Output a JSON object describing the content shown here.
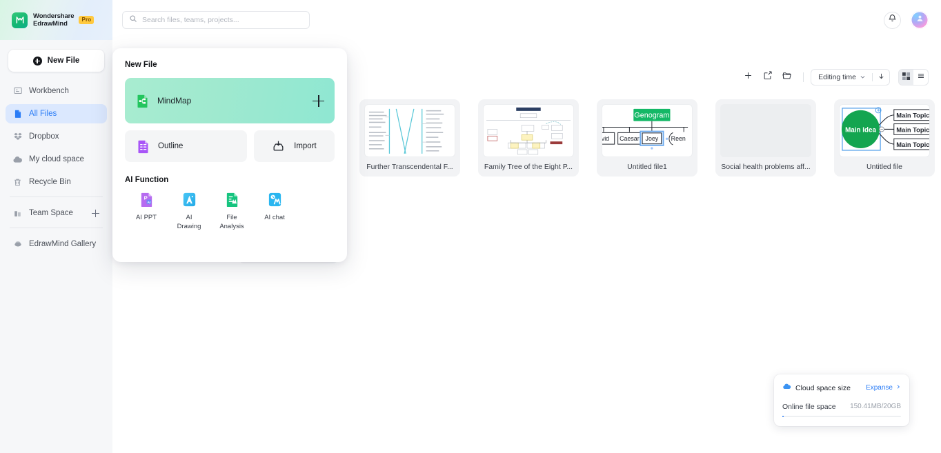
{
  "brand": {
    "name_line1": "Wondershare",
    "name_line2": "EdrawMind",
    "badge": "Pro",
    "logo_icon": "edrawmind-logo-icon"
  },
  "sidebar": {
    "new_file_button": "New File",
    "items": [
      {
        "label": "Workbench",
        "icon": "workbench-icon",
        "active": false
      },
      {
        "label": "All Files",
        "icon": "files-icon",
        "active": true
      },
      {
        "label": "Dropbox",
        "icon": "dropbox-icon",
        "active": false
      },
      {
        "label": "My cloud space",
        "icon": "cloud-icon",
        "active": false
      },
      {
        "label": "Recycle Bin",
        "icon": "trash-icon",
        "active": false
      },
      {
        "label": "Team Space",
        "icon": "team-icon",
        "active": false,
        "trailing": "plus-icon"
      },
      {
        "label": "EdrawMind Gallery",
        "icon": "gallery-icon",
        "active": false
      }
    ]
  },
  "search": {
    "placeholder": "Search files, teams, projects...",
    "value": "",
    "icon": "search-icon"
  },
  "header": {
    "notification_icon": "bell-icon",
    "avatar_icon": "user-avatar-icon"
  },
  "toolbar": {
    "new_icon": "plus-icon",
    "new_doc_icon": "new-document-icon",
    "new_folder_icon": "new-folder-icon",
    "sort_label": "Editing time",
    "sort_chevron_icon": "chevron-down-icon",
    "sort_direction_icon": "arrow-down-icon",
    "grid_view_icon": "grid-view-icon",
    "list_view_icon": "list-view-icon",
    "active_view": "grid"
  },
  "files": [
    {
      "name": "Further Transcendental F...",
      "thumb": "lines-diagram"
    },
    {
      "name": "Family Tree of the Eight P...",
      "thumb": "family-tree-diagram"
    },
    {
      "name": "Untitled file1",
      "thumb": "genogram-diagram",
      "genogram": {
        "root": "Genogram",
        "children": [
          "avid",
          "Caesar",
          "Joey",
          "Reen"
        ]
      }
    },
    {
      "name": "Social health problems aff...",
      "thumb": "blank"
    },
    {
      "name": "Untitled file",
      "thumb": "mindmap-diagram",
      "mindmap": {
        "center": "Main Idea",
        "topics": [
          "Main Topic",
          "Main Topic",
          "Main Topic"
        ]
      }
    }
  ],
  "new_file_panel": {
    "section_title": "New File",
    "mindmap": {
      "label": "MindMap",
      "icon": "mindmap-file-icon",
      "add_icon": "plus-icon"
    },
    "outline": {
      "label": "Outline",
      "icon": "outline-file-icon"
    },
    "import": {
      "label": "Import",
      "icon": "import-icon"
    },
    "ai_section_title": "AI Function",
    "ai_functions": [
      {
        "label": "AI PPT",
        "icon": "ai-ppt-icon"
      },
      {
        "label": "AI\nDrawing",
        "label_l1": "AI",
        "label_l2": "Drawing",
        "icon": "ai-drawing-icon"
      },
      {
        "label": "File\nAnalysis",
        "label_l1": "File",
        "label_l2": "Analysis",
        "icon": "file-analysis-icon"
      },
      {
        "label": "AI chat",
        "label_l1": "AI chat",
        "label_l2": "",
        "icon": "ai-chat-icon"
      }
    ]
  },
  "cloud_space": {
    "title": "Cloud space size",
    "icon": "cloud-icon",
    "expand_label": "Expanse",
    "expand_icon": "chevron-right-icon",
    "row_label": "Online file space",
    "row_value": "150.41MB/20GB",
    "progress_percent": 0.7
  },
  "colors": {
    "accent_blue": "#2a7cf6",
    "brand_green": "#12b673",
    "pro_badge": "#ffc93f",
    "mindmap_card": "#9fe9cf"
  }
}
